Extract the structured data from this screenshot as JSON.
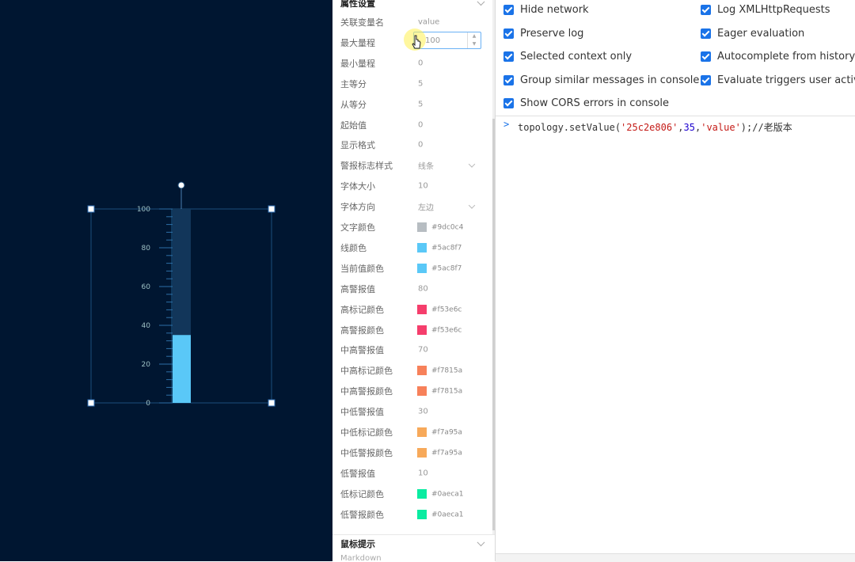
{
  "canvas": {
    "gauge": {
      "ticks": [
        "100",
        "80",
        "60",
        "40",
        "20",
        "0"
      ],
      "value": 35,
      "max": 100,
      "min": 0,
      "fill_color": "#5ac8f7",
      "track_color": "#12365a",
      "line_color": "#5ac8f7",
      "text_color": "#9dc0c4"
    }
  },
  "props": {
    "section_title": "属性设置",
    "input_value": "100",
    "rows": [
      {
        "label": "关联变量名",
        "value": "value"
      },
      {
        "label": "最大量程",
        "value": ""
      },
      {
        "label": "最小量程",
        "value": "0"
      },
      {
        "label": "主等分",
        "value": "5"
      },
      {
        "label": "从等分",
        "value": "5"
      },
      {
        "label": "起始值",
        "value": "0"
      },
      {
        "label": "显示格式",
        "value": "0"
      },
      {
        "label": "警报标志样式",
        "value": "线条"
      },
      {
        "label": "字体大小",
        "value": "10"
      },
      {
        "label": "字体方向",
        "value": "左边"
      },
      {
        "label": "文字颜色",
        "value": "#9dc0c4",
        "color": "#b7bdc2"
      },
      {
        "label": "线颜色",
        "value": "#5ac8f7",
        "color": "#5ac8f7"
      },
      {
        "label": "当前值颜色",
        "value": "#5ac8f7",
        "color": "#5ac8f7"
      },
      {
        "label": "高警报值",
        "value": "80"
      },
      {
        "label": "高标记颜色",
        "value": "#f53e6c",
        "color": "#f53e6c"
      },
      {
        "label": "高警报颜色",
        "value": "#f53e6c",
        "color": "#f53e6c"
      },
      {
        "label": "中高警报值",
        "value": "70"
      },
      {
        "label": "中高标记颜色",
        "value": "#f7815a",
        "color": "#f7815a"
      },
      {
        "label": "中高警报颜色",
        "value": "#f7815a",
        "color": "#f7815a"
      },
      {
        "label": "中低警报值",
        "value": "30"
      },
      {
        "label": "中低标记颜色",
        "value": "#f7a95a",
        "color": "#f7a95a"
      },
      {
        "label": "中低警报颜色",
        "value": "#f7a95a",
        "color": "#f7a95a"
      },
      {
        "label": "低警报值",
        "value": "10"
      },
      {
        "label": "低标记颜色",
        "value": "#0aeca1",
        "color": "#0aeca1"
      },
      {
        "label": "低警报颜色",
        "value": "#0aeca1",
        "color": "#0aeca1"
      }
    ],
    "tooltip_section": "鼠标提示",
    "tooltip_first": "Markdown"
  },
  "console": {
    "settings": [
      {
        "label": "Hide network",
        "checked": true
      },
      {
        "label": "Log XMLHttpRequests",
        "checked": true
      },
      {
        "label": "Preserve log",
        "checked": true
      },
      {
        "label": "Eager evaluation",
        "checked": true
      },
      {
        "label": "Selected context only",
        "checked": true
      },
      {
        "label": "Autocomplete from history",
        "checked": true
      },
      {
        "label": "Group similar messages in console",
        "checked": true
      },
      {
        "label": "Evaluate triggers user activation",
        "checked": true
      },
      {
        "label": "Show CORS errors in console",
        "checked": true
      }
    ],
    "prompt_symbol": ">",
    "command": {
      "fn": "topology.setValue(",
      "arg1": "'25c2e806'",
      "sep1": ",",
      "arg2": "35",
      "sep2": ",",
      "arg3": "'value'",
      "tail": ");//老版本"
    }
  }
}
